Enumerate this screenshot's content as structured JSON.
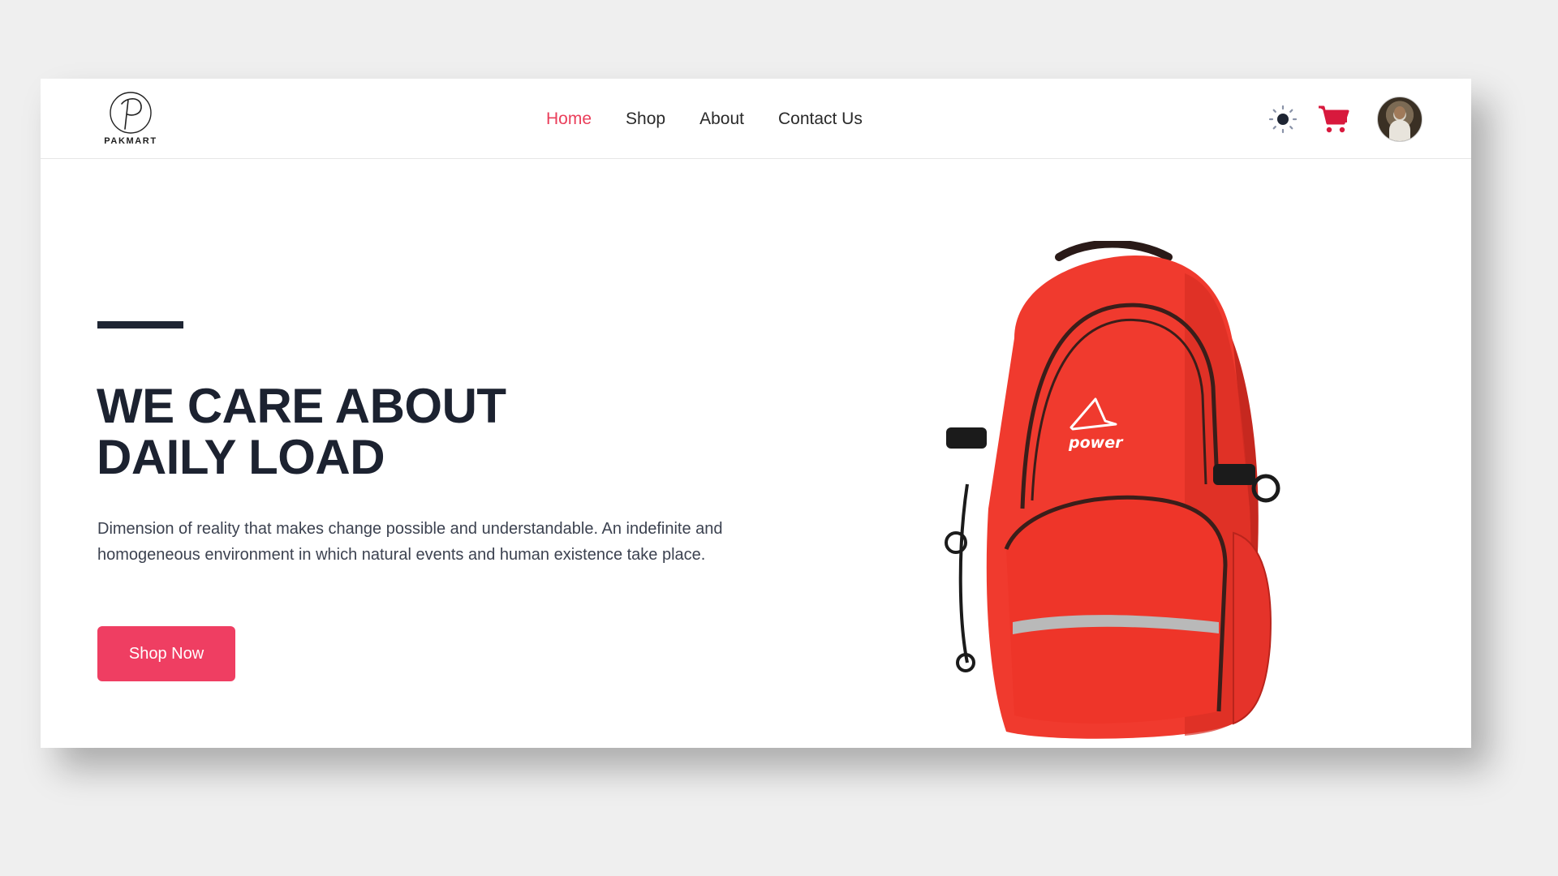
{
  "brand": {
    "name": "PAKMART",
    "logo_letter": "P"
  },
  "nav": {
    "links": [
      {
        "label": "Home",
        "active": true
      },
      {
        "label": "Shop",
        "active": false
      },
      {
        "label": "About",
        "active": false
      },
      {
        "label": "Contact Us",
        "active": false
      }
    ],
    "icons": [
      "sun-icon",
      "cart-icon",
      "user-avatar"
    ]
  },
  "hero": {
    "title_line1": "WE CARE ABOUT",
    "title_line2": "DAILY LOAD",
    "description": "Dimension of reality that makes change possible and understandable. An indefinite and homogeneous environment in which natural events and human existence take place.",
    "cta_label": "Shop Now",
    "product_brand_text": "power"
  },
  "colors": {
    "accent": "#ef3e62",
    "active_link": "#ea3e5a",
    "heading": "#1c2230",
    "backpack": "#f03a2e"
  }
}
